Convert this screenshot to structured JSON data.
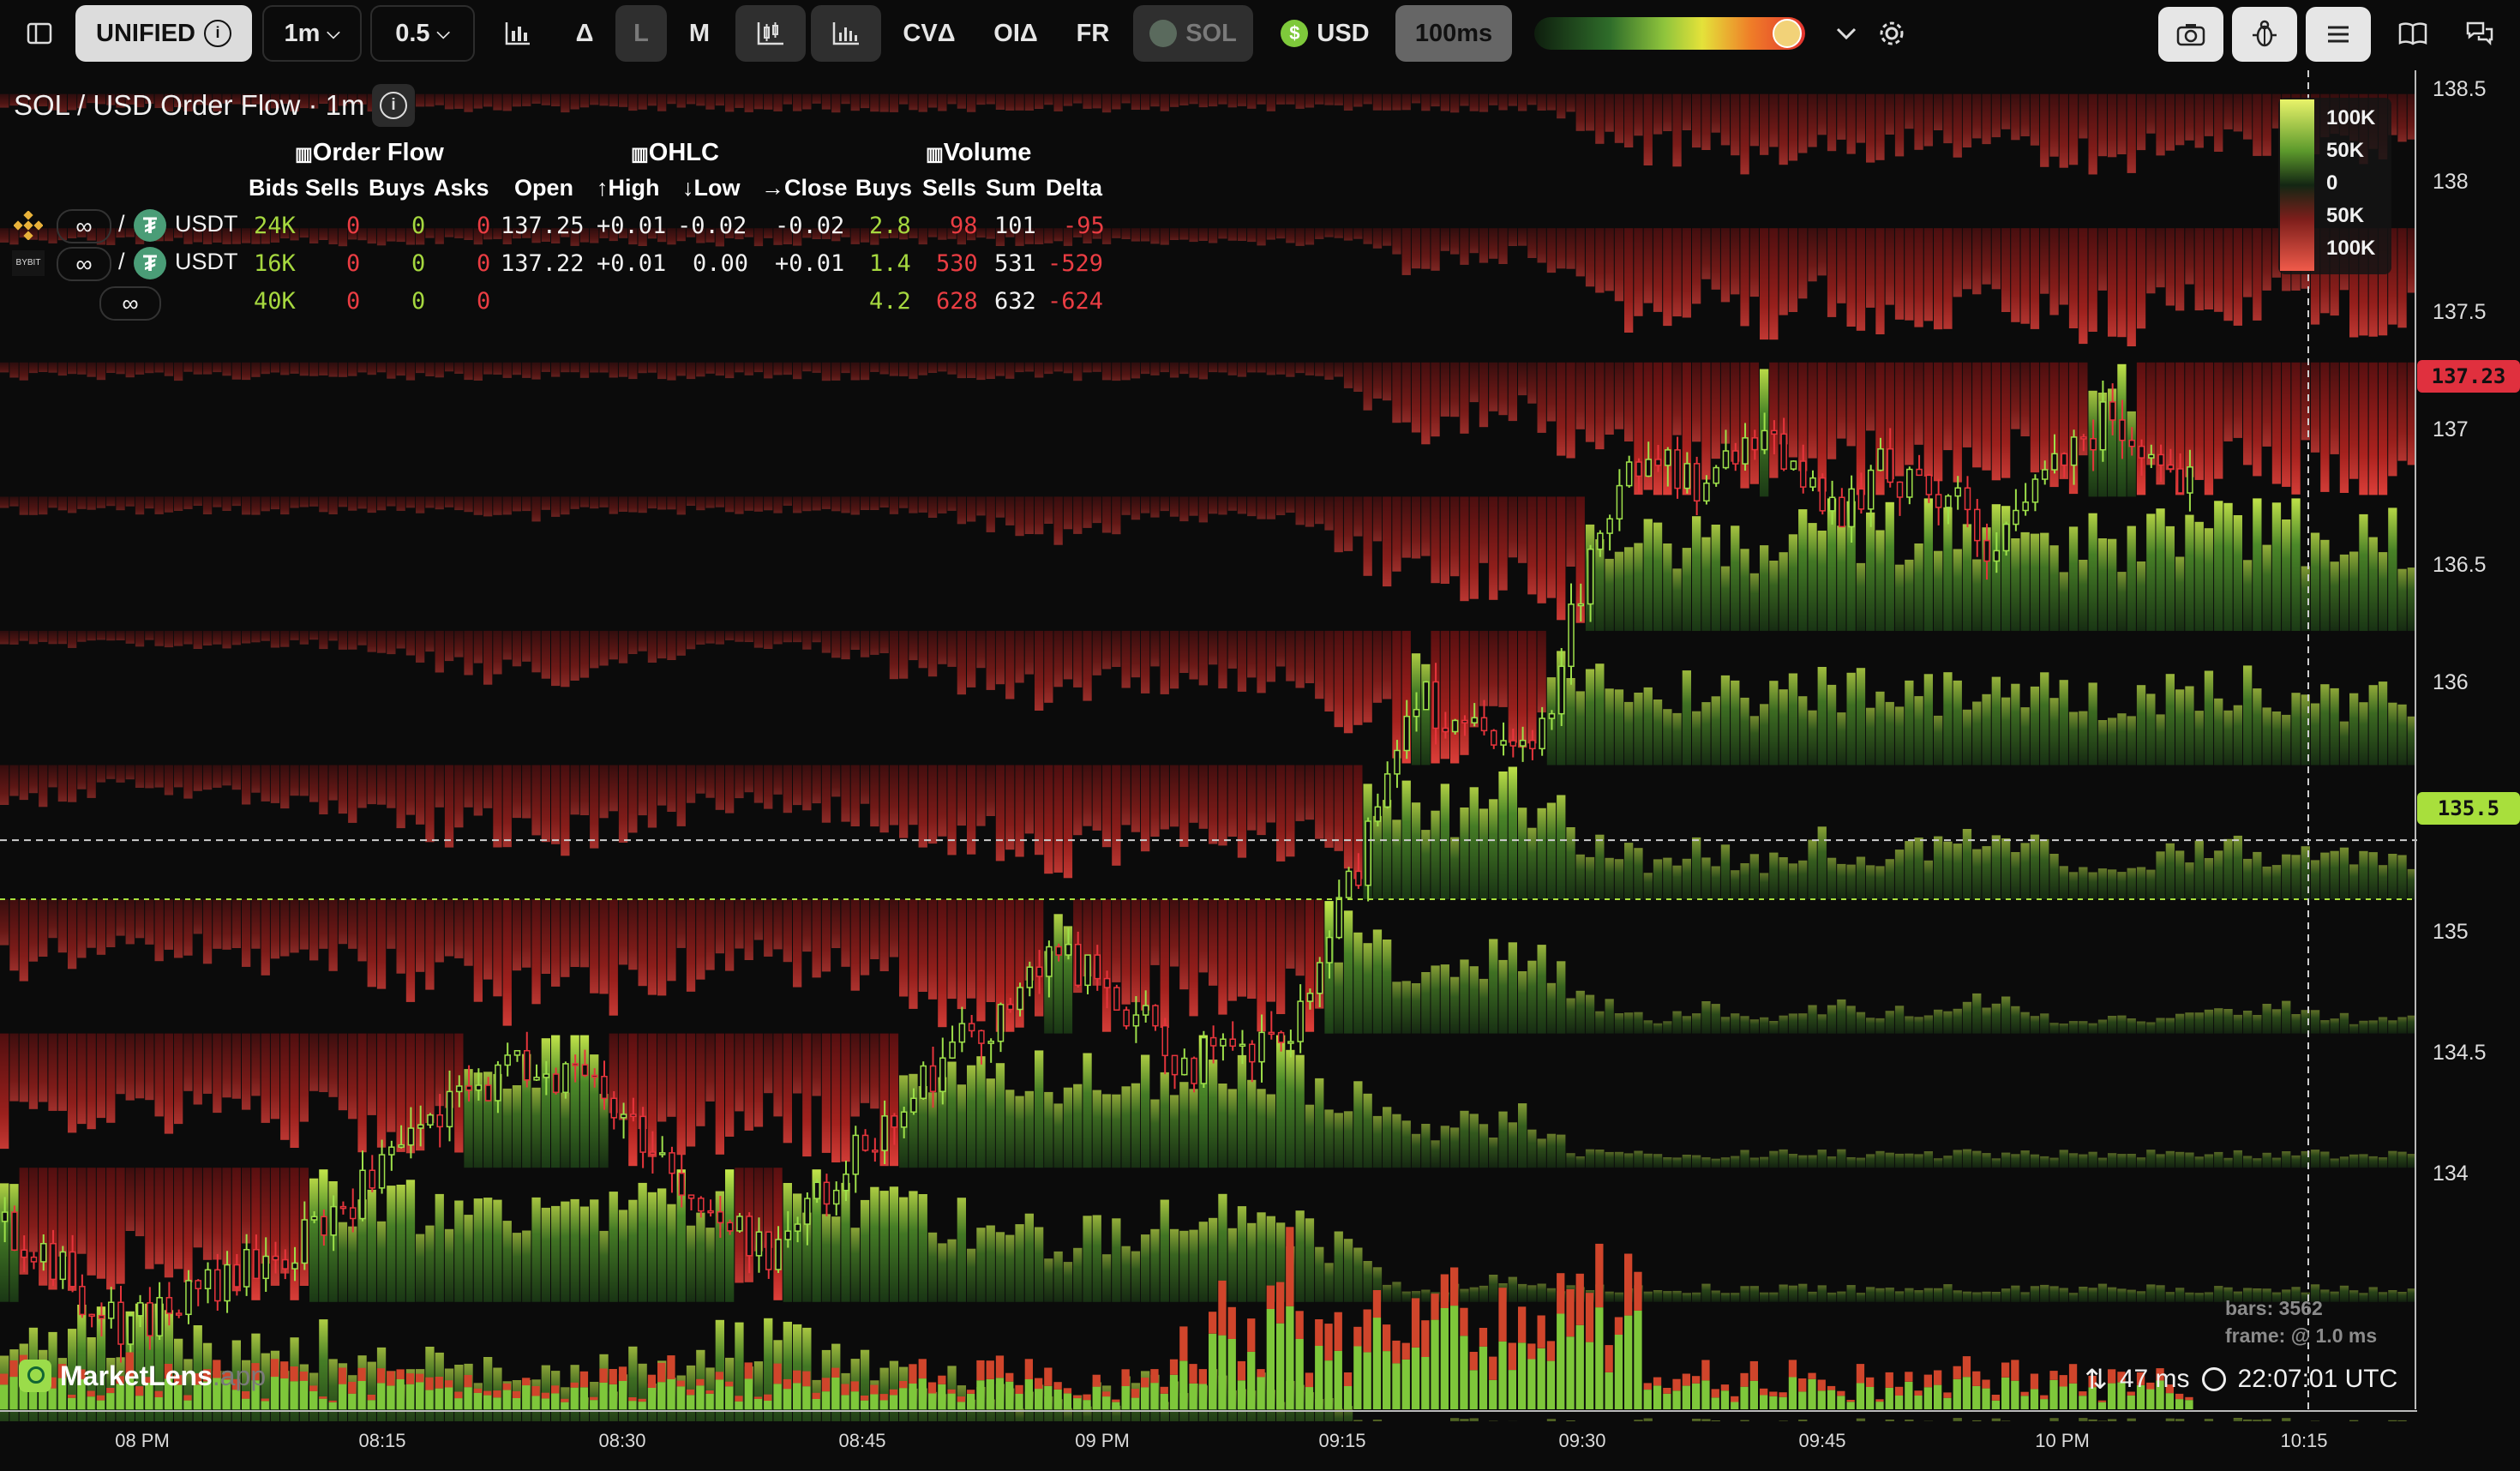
{
  "toolbar": {
    "account_mode": "UNIFIED",
    "timeframe": "1m",
    "bucket_size": "0.5",
    "buttons": [
      "Δ",
      "L",
      "M"
    ],
    "indicators": [
      "CVΔ",
      "OIΔ",
      "FR"
    ],
    "base_asset": "SOL",
    "quote_asset": "USD",
    "refresh_rate": "100ms",
    "icons": [
      "sidebar-toggle-icon",
      "bar-chart-icon",
      "candles-icon",
      "volume-icon",
      "chevron-down-icon",
      "gear-icon",
      "camera-icon",
      "bug-icon",
      "menu-icon",
      "book-icon",
      "chat-icon"
    ]
  },
  "chart": {
    "title": "SOL / USD Order Flow · 1m",
    "legend": [
      "100K",
      "50K",
      "0",
      "50K",
      "100K"
    ],
    "price_labels": [
      "138.5",
      "138",
      "137.5",
      "137",
      "136.5",
      "136",
      "135",
      "134.5",
      "134"
    ],
    "last_price_tag": "137.23",
    "cursor_price_tag": "135.5",
    "time_labels": [
      "08 PM",
      "08:15",
      "08:30",
      "08:45",
      "09 PM",
      "09:15",
      "09:30",
      "09:45",
      "10 PM",
      "10:15"
    ],
    "bars_count": "bars: 3562",
    "frame_time": "frame: @ 1.0 ms",
    "latency": "47 ms",
    "clock": "22:07:01 UTC",
    "brand": "MarketLens",
    "brand_suffix": ".app"
  },
  "flow_table": {
    "groups": [
      "Order Flow",
      "OHLC",
      "Volume"
    ],
    "columns": [
      "Bids",
      "Sells",
      "Buys",
      "Asks",
      "Open",
      "↑High",
      "↓Low",
      "→Close",
      "Buys",
      "Sells",
      "Sum",
      "Delta"
    ],
    "rows": [
      {
        "exchange": "Binance",
        "quote": "USDT",
        "bids": "24K",
        "sells": "0",
        "buys": "0",
        "asks": "0",
        "open": "137.25",
        "high": "+0.01",
        "low": "-0.02",
        "close": "-0.02",
        "vbuys": "2.8",
        "vsells": "98",
        "sum": "101",
        "delta": "-95"
      },
      {
        "exchange": "Bybit",
        "quote": "USDT",
        "bids": "16K",
        "sells": "0",
        "buys": "0",
        "asks": "0",
        "open": "137.22",
        "high": "+0.01",
        "low": "0.00",
        "close": "+0.01",
        "vbuys": "1.4",
        "vsells": "530",
        "sum": "531",
        "delta": "-529"
      },
      {
        "exchange": "∞",
        "quote": "",
        "bids": "40K",
        "sells": "0",
        "buys": "0",
        "asks": "0",
        "open": "",
        "high": "",
        "low": "",
        "close": "",
        "vbuys": "4.2",
        "vsells": "628",
        "sum": "632",
        "delta": "-624"
      }
    ]
  },
  "chart_data": {
    "type": "heatmap",
    "title": "SOL / USD Order Flow · 1m",
    "x_ticks": [
      "08 PM",
      "08:15",
      "08:30",
      "08:45",
      "09 PM",
      "09:15",
      "09:30",
      "09:45",
      "10 PM",
      "10:15"
    ],
    "y_ticks": [
      138.5,
      138,
      137.5,
      137,
      136.5,
      136,
      135,
      134.5,
      134
    ],
    "ylim": [
      133.6,
      138.55
    ],
    "last_price": 137.23,
    "cursor_price": 135.5,
    "price_path": [
      134.3,
      134.1,
      133.9,
      134.0,
      134.1,
      134.2,
      134.4,
      134.6,
      134.8,
      134.9,
      134.8,
      134.6,
      134.3,
      134.2,
      134.4,
      134.7,
      134.9,
      135.1,
      135.3,
      135.1,
      134.9,
      134.9,
      135.0,
      135.6,
      136.3,
      136.1,
      136.0,
      136.8,
      137.2,
      137.0,
      137.3,
      136.9,
      137.1,
      137.0,
      136.8,
      137.2,
      137.3,
      137.1,
      137.0,
      137.0,
      137.2,
      137.2
    ]
  }
}
